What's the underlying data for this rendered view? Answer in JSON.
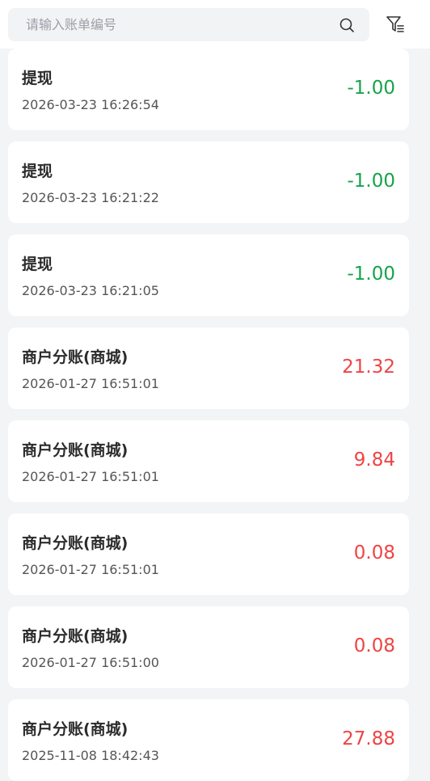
{
  "search": {
    "placeholder": "请输入账单编号"
  },
  "icons": {
    "search": "search-icon",
    "filter": "filter-icon"
  },
  "colors": {
    "negative": "#16a34a",
    "positive": "#ef4444"
  },
  "transactions": [
    {
      "title": "提现",
      "time": "2026-03-23 16:26:54",
      "amount": "-1.00",
      "type": "negative"
    },
    {
      "title": "提现",
      "time": "2026-03-23 16:21:22",
      "amount": "-1.00",
      "type": "negative"
    },
    {
      "title": "提现",
      "time": "2026-03-23 16:21:05",
      "amount": "-1.00",
      "type": "negative"
    },
    {
      "title": "商户分账(商城)",
      "time": "2026-01-27 16:51:01",
      "amount": "21.32",
      "type": "positive"
    },
    {
      "title": "商户分账(商城)",
      "time": "2026-01-27 16:51:01",
      "amount": "9.84",
      "type": "positive"
    },
    {
      "title": "商户分账(商城)",
      "time": "2026-01-27 16:51:01",
      "amount": "0.08",
      "type": "positive"
    },
    {
      "title": "商户分账(商城)",
      "time": "2026-01-27 16:51:00",
      "amount": "0.08",
      "type": "positive"
    },
    {
      "title": "商户分账(商城)",
      "time": "2025-11-08 18:42:43",
      "amount": "27.88",
      "type": "positive"
    }
  ]
}
